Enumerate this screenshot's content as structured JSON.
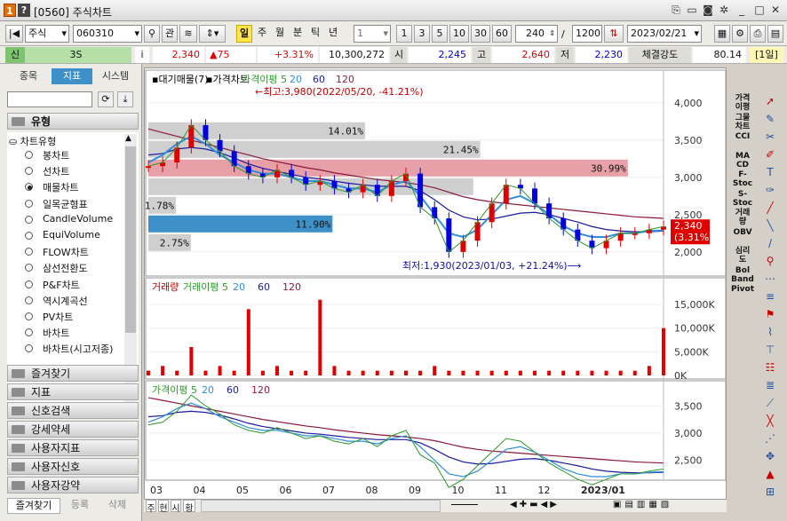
{
  "window": {
    "code": "[0560]",
    "title": "주식차트",
    "help_label": "?"
  },
  "toolbar": {
    "market": "주식",
    "stock_code": "060310",
    "btn_gwan": "관",
    "periods": [
      "일",
      "주",
      "월",
      "분",
      "틱",
      "년"
    ],
    "selected_period": "일",
    "interval_value": "1",
    "presets": [
      "1",
      "3",
      "5",
      "10",
      "30",
      "60"
    ],
    "count": "240",
    "total": "1200",
    "slash": "/",
    "date": "2023/02/21",
    "period_badge": "[1일]"
  },
  "quote": {
    "tag": "신",
    "name": "3S",
    "info_icon": "i",
    "price": "2,340",
    "change": "▲75",
    "rate": "+3.31%",
    "volume": "10,300,272",
    "open_label": "시",
    "open": "2,245",
    "high_label": "고",
    "high": "2,640",
    "low_label": "저",
    "low": "2,230",
    "strength_label": "체결강도",
    "strength": "80.14"
  },
  "left_panel": {
    "tabs": [
      "종목",
      "지표",
      "시스템"
    ],
    "selected_tab": "지표",
    "search_value": "",
    "section": "유형",
    "tree_root": "차트유형",
    "chart_types": [
      "봉차트",
      "선차트",
      "매물차트",
      "일목균형표",
      "CandleVolume",
      "EquiVolume",
      "FLOW차트",
      "삼선전환도",
      "P&F차트",
      "역시계곡선",
      "PV차트",
      "바차트",
      "바차트(시고저종)"
    ],
    "selected_chart_type": "매물차트",
    "folders": [
      "즐겨찾기",
      "지표",
      "신호검색",
      "강세약세",
      "사용자지표",
      "사용자신호",
      "사용자강약"
    ],
    "bottom_tabs": [
      "즐겨찾기",
      "등록",
      "삭제"
    ]
  },
  "chart": {
    "price_legend": [
      "대기매물(7)",
      "가격차트",
      "가격이평 5",
      "20",
      "60",
      "120"
    ],
    "high_note": "←최고:3,980(2022/05/20, -41.21%)",
    "low_note": "최저:1,930(2023/01/03, +21.24%)⟶",
    "current_price": "2,340",
    "current_rate": "(3.31%)",
    "price_axis": [
      "4,000",
      "3,500",
      "3,000",
      "2,500",
      "2,000"
    ],
    "volume_legend": [
      "거래량",
      "거래이평 5",
      "20",
      "60",
      "120"
    ],
    "volume_axis": [
      "15,000K",
      "10,000K",
      "5,000K",
      "0K"
    ],
    "ma_legend": [
      "가격이평 5",
      "20",
      "60",
      "120"
    ],
    "ma_axis": [
      "3,500",
      "3,000",
      "2,500"
    ],
    "x_axis": [
      "03",
      "04",
      "05",
      "06",
      "07",
      "08",
      "09",
      "10",
      "11",
      "12",
      "2023/01"
    ],
    "bottom_buttons": [
      "주",
      "현",
      "시",
      "황"
    ]
  },
  "chart_data": {
    "type": "bar",
    "title": "매물차트",
    "volume_profile": [
      {
        "label": "14.01%",
        "value": 14.01,
        "price_from": 3500,
        "price_to": 3750
      },
      {
        "label": "21.45%",
        "value": 21.45,
        "price_from": 3250,
        "price_to": 3500
      },
      {
        "label": "30.99%",
        "value": 30.99,
        "price_from": 3000,
        "price_to": 3250,
        "highlight": "#e8a0a8"
      },
      {
        "label": "",
        "value": 21.0,
        "price_from": 2750,
        "price_to": 3000
      },
      {
        "label": "1.78%",
        "value": 1.78,
        "price_from": 2500,
        "price_to": 2750
      },
      {
        "label": "11.90%",
        "value": 11.9,
        "price_from": 2250,
        "price_to": 2500,
        "highlight": "#3d91c8"
      },
      {
        "label": "2.75%",
        "value": 2.75,
        "price_from": 2000,
        "price_to": 2250
      }
    ],
    "ylim": [
      1700,
      4200
    ],
    "price_series": [
      3150,
      3200,
      3400,
      3700,
      3500,
      3350,
      3150,
      3050,
      3000,
      3100,
      3000,
      2900,
      2950,
      2850,
      2800,
      2900,
      2750,
      2950,
      3050,
      2600,
      2450,
      2000,
      2150,
      2400,
      2650,
      2900,
      2850,
      2650,
      2450,
      2300,
      2150,
      2050,
      2150,
      2250,
      2250,
      2300,
      2340
    ],
    "ma20_series": [
      3200,
      3300,
      3450,
      3550,
      3450,
      3300,
      3200,
      3100,
      3050,
      3050,
      3000,
      2950,
      2950,
      2900,
      2850,
      2850,
      2800,
      2900,
      2950,
      2750,
      2500,
      2250,
      2200,
      2300,
      2500,
      2700,
      2750,
      2650,
      2500,
      2350,
      2250,
      2200,
      2200,
      2250,
      2250,
      2280,
      2290
    ],
    "ma60_series": [
      3300,
      3320,
      3380,
      3400,
      3380,
      3330,
      3260,
      3180,
      3120,
      3080,
      3040,
      3000,
      2980,
      2950,
      2920,
      2900,
      2880,
      2880,
      2880,
      2820,
      2700,
      2560,
      2470,
      2430,
      2440,
      2480,
      2520,
      2530,
      2500,
      2450,
      2400,
      2340,
      2300,
      2280,
      2270,
      2270,
      2280
    ],
    "ma120_series": [
      3650,
      3600,
      3550,
      3500,
      3450,
      3400,
      3350,
      3300,
      3250,
      3210,
      3170,
      3130,
      3100,
      3060,
      3030,
      3000,
      2970,
      2950,
      2930,
      2900,
      2860,
      2800,
      2740,
      2700,
      2670,
      2650,
      2630,
      2610,
      2590,
      2570,
      2550,
      2530,
      2510,
      2490,
      2470,
      2460,
      2450
    ],
    "volume_series": [
      1,
      2,
      1,
      6,
      1,
      2,
      1,
      14,
      1,
      2,
      1,
      1,
      16,
      2,
      1,
      1,
      1,
      1,
      1,
      1,
      2,
      1,
      1,
      1,
      1,
      1,
      1,
      1,
      1,
      1,
      1,
      1,
      1,
      1,
      1,
      2,
      10
    ],
    "colors": {
      "price_up": "#e00000",
      "price_down": "#0000e0",
      "ma5": "#2a9a2a",
      "ma20": "#2f8fd8",
      "ma60": "#1a1aa0",
      "ma120": "#8a1a3a"
    }
  }
}
